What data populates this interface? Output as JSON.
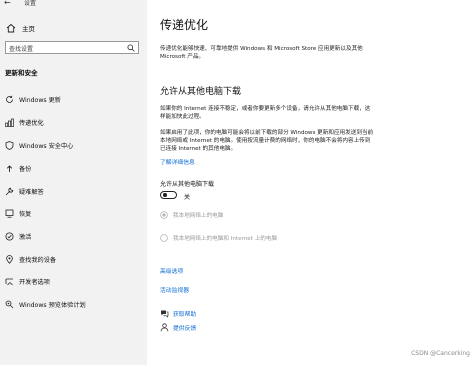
{
  "window": {
    "title": "设置"
  },
  "sidebar": {
    "home_label": "主页",
    "search_placeholder": "查找设置",
    "section_title": "更新和安全",
    "items": [
      {
        "label": "Windows 更新",
        "icon": "sync-icon"
      },
      {
        "label": "传递优化",
        "icon": "delivery-optimization-icon",
        "active": true
      },
      {
        "label": "Windows 安全中心",
        "icon": "shield-icon"
      },
      {
        "label": "备份",
        "icon": "backup-icon"
      },
      {
        "label": "疑难解答",
        "icon": "wrench-icon"
      },
      {
        "label": "恢复",
        "icon": "recovery-icon"
      },
      {
        "label": "激活",
        "icon": "activation-icon"
      },
      {
        "label": "查找我的设备",
        "icon": "find-device-icon"
      },
      {
        "label": "开发者选项",
        "icon": "developer-icon"
      },
      {
        "label": "Windows 预览体验计划",
        "icon": "insider-icon"
      }
    ]
  },
  "main": {
    "title": "传递优化",
    "description": "传递优化能够快速、可靠地提供 Windows 和 Microsoft Store 应用更新以及其他 Microsoft 产品。",
    "allow_heading": "允许从其他电脑下载",
    "para1": "如果你的 Internet 连接不稳定，或者你要更新多个设备，请允许从其他电脑下载，这样能加快此过程。",
    "para2": "如果启用了此项，你的电脑可能会将以前下载的部分 Windows 更新和应用发送到当前本地网络或 Internet 的电脑。使用按流量计费的网络时，你的电脑不会将内容上传到已连接 Internet 的其他电脑。",
    "learn_more": "了解详细信息",
    "toggle_label": "允许从其他电脑下载",
    "toggle_state": "关",
    "radio_options": [
      "我本地网络上的电脑",
      "我本地网络上的电脑和 Internet 上的电脑"
    ],
    "advanced_link": "高级选项",
    "monitor_link": "活动监视器",
    "help": [
      {
        "label": "获取帮助",
        "icon": "help-chat-icon"
      },
      {
        "label": "提供反馈",
        "icon": "feedback-icon"
      }
    ]
  },
  "watermark": "CSDN @Cancerking",
  "colors": {
    "accent": "#0b6bd3",
    "sidebar_bg": "#f2f2f2",
    "disabled_text": "#9a9a9a"
  }
}
